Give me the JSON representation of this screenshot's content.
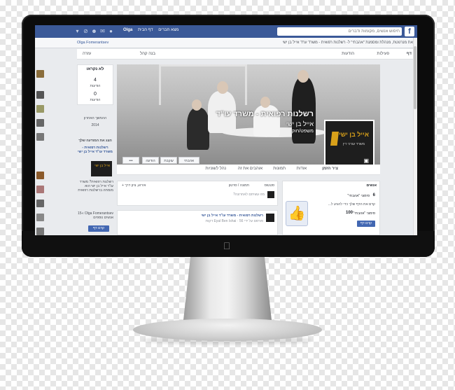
{
  "topbar": {
    "search_placeholder": "חיפוש אנשים, מקומות ודברים",
    "user": "Olga",
    "home": "דף הבית",
    "find_friends": "מצא חברים"
  },
  "pagebar": {
    "main": "את מנרטטת, מנהלת ומסמנת \"אהבתי\" ל- רשלנות רפואית - משרד עו\"ד אייל בן ישי",
    "account": "Olga Fomerantsev"
  },
  "subnav": {
    "page": "דף",
    "activity": "פעילות",
    "notifications": "הודעות",
    "insights": "בנה קהל",
    "help": "עזרה"
  },
  "cover": {
    "title": "רשלנות רפואית - משרד עו\"ד",
    "subtitle": "אייל בן ישי",
    "category": "משפט/חוק",
    "logo_name": "אייל בן ישי",
    "logo_sub": "משרד עורכי דין"
  },
  "cover_buttons": {
    "like": "אהבתי",
    "follow": "עוקבת",
    "message": "הודעה",
    "more": "•••"
  },
  "tabs": {
    "timeline": "ציר הזמן",
    "about": "אודות",
    "photos": "תמונות",
    "likes": "אוהבים את זה",
    "more": "נהל לשוניות"
  },
  "left": {
    "unread": "לא נקראו",
    "messages_count": "4",
    "messages": "הודעות",
    "notifs_count": "0",
    "notifs": "הודעות",
    "recent": "ההמשך האחרון",
    "year": "2014",
    "promo_title": "הצג את המודעה שלך",
    "promo_name": "רשלנות רפואית - משרד עו\"ד אייל בן ישי",
    "promo_text": "רשלנות רפואית? משרד עו\"ד אייל בן ישי הוא מומחה ברשלנות רפואית",
    "promo_likes": "Olga Fomerantsev ו-15 אנשים נוספים",
    "promo_btn": "קדם דף"
  },
  "composer": {
    "status": "סטטוס",
    "photo": "תמונה / סרטון",
    "event": "אירוע, ציון דרך +",
    "prompt": "מה עשיתם לאחרונה?"
  },
  "post": {
    "page": "רשלנות רפואית - משרד עו\"ד אייל בן ישי",
    "meta": "פורסם על ידי Eyal Ben Ishai · 56 דקות",
    "text": "רשלנות רפואית..."
  },
  "people": {
    "header": "אנשים",
    "likes_count": "6",
    "likes_label": "סימוני \"אהבתי\"",
    "prompt": "קדם את הדף שלך כדי להגיע ל...",
    "target_count": "100",
    "target_label": "סימוני \"אהבתי\"",
    "promote": "קדם דף"
  }
}
